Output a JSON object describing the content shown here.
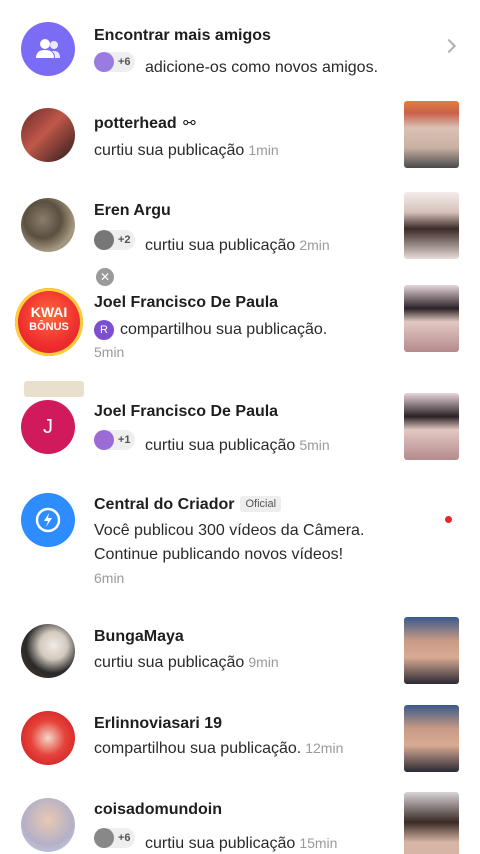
{
  "find_friends": {
    "title": "Encontrar mais amigos",
    "count": "+6",
    "subtitle": "adicione-os como novos amigos."
  },
  "notifications": [
    {
      "user": "potterhead",
      "action": "curtiu sua publicação",
      "time": "1min"
    },
    {
      "user": "Eren Argu",
      "count": "+2",
      "action": "curtiu sua publicação",
      "time": "2min"
    },
    {
      "user": "Joel Francisco De Paula",
      "initial": "R",
      "action": "compartilhou sua publicação.",
      "time": "5min"
    },
    {
      "user": "Joel Francisco De Paula",
      "count": "+1",
      "action": "curtiu sua publicação",
      "time": "5min",
      "avatar_letter": "J"
    },
    {
      "user": "Central do Criador",
      "badge": "Oficial",
      "line1": "Você publicou 300 vídeos da Câmera.",
      "line2": "Continue publicando novos vídeos!",
      "time": "6min"
    },
    {
      "user": "BungaMaya",
      "action": "curtiu sua publicação",
      "time": "9min"
    },
    {
      "user": "Erlinnoviasari 19",
      "action": "compartilhou sua publicação.",
      "time": "12min"
    },
    {
      "user": "coisadomundoin",
      "count": "+6",
      "action": "curtiu sua publicação",
      "time": "15min"
    }
  ],
  "kwai_bonus": {
    "line1": "KWAI",
    "line2": "BÔNUS"
  },
  "colors": {
    "accent": "#7b6cf6",
    "creator_blue": "#2d8cff",
    "joel_pink": "#d01a5b",
    "unread_dot": "#e6272a"
  }
}
